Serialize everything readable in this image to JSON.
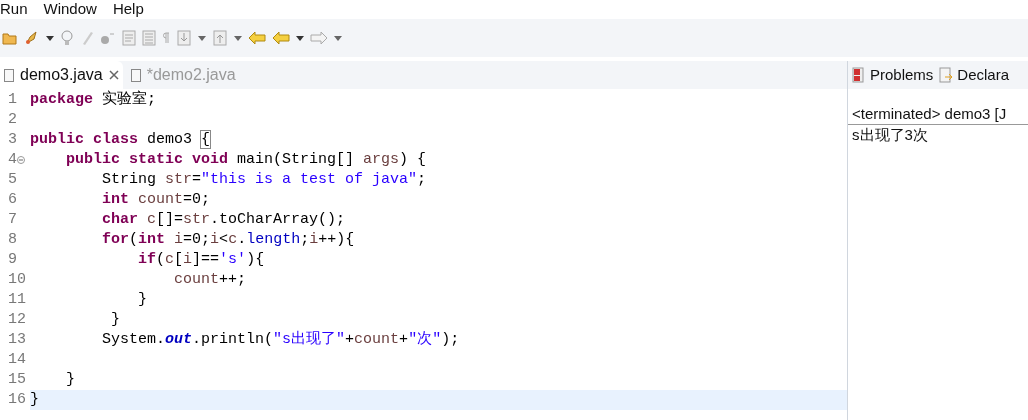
{
  "menu": [
    "Run",
    "Window",
    "Help"
  ],
  "editor_tabs": [
    {
      "label": "demo3.java",
      "selected": true,
      "closable": true
    },
    {
      "label": "*demo2.java",
      "selected": false,
      "closable": false
    }
  ],
  "code_lines": [
    {
      "number": "1",
      "fold": false,
      "current": false,
      "tokens": [
        {
          "kind": "keyword",
          "text": "package "
        },
        {
          "kind": "plain",
          "text": "实验室;"
        }
      ]
    },
    {
      "number": "2",
      "fold": false,
      "current": false
    },
    {
      "number": "3",
      "fold": false,
      "current": false,
      "tokens": [
        {
          "kind": "keyword",
          "text": "public class "
        },
        {
          "kind": "plain",
          "text": "demo3 "
        },
        {
          "kind": "matched_bracket",
          "text": "{"
        }
      ]
    },
    {
      "number": "4",
      "fold": true,
      "current": false,
      "tokens": [
        {
          "kind": "keyword",
          "text": "    public static void "
        },
        {
          "kind": "plain",
          "text": "main(String[] "
        },
        {
          "kind": "local",
          "text": "args"
        },
        {
          "kind": "plain",
          "text": ") {"
        }
      ]
    },
    {
      "number": "5",
      "fold": false,
      "current": false,
      "tokens": [
        {
          "kind": "plain",
          "text": "        String "
        },
        {
          "kind": "local",
          "text": "str"
        },
        {
          "kind": "plain",
          "text": "="
        },
        {
          "kind": "string",
          "text": "\"this is a test of java\""
        },
        {
          "kind": "plain",
          "text": ";"
        }
      ]
    },
    {
      "number": "6",
      "fold": false,
      "current": false,
      "tokens": [
        {
          "kind": "keyword",
          "text": "        int "
        },
        {
          "kind": "local",
          "text": "count"
        },
        {
          "kind": "plain",
          "text": "=0;"
        }
      ]
    },
    {
      "number": "7",
      "fold": false,
      "current": false,
      "tokens": [
        {
          "kind": "keyword",
          "text": "        char "
        },
        {
          "kind": "local",
          "text": "c"
        },
        {
          "kind": "plain",
          "text": "[]="
        },
        {
          "kind": "local",
          "text": "str"
        },
        {
          "kind": "plain",
          "text": ".toCharArray();"
        }
      ]
    },
    {
      "number": "8",
      "fold": false,
      "current": false,
      "tokens": [
        {
          "kind": "keyword",
          "text": "        for"
        },
        {
          "kind": "plain",
          "text": "("
        },
        {
          "kind": "keyword",
          "text": "int "
        },
        {
          "kind": "local",
          "text": "i"
        },
        {
          "kind": "plain",
          "text": "=0;"
        },
        {
          "kind": "local",
          "text": "i"
        },
        {
          "kind": "plain",
          "text": "<"
        },
        {
          "kind": "local",
          "text": "c"
        },
        {
          "kind": "plain",
          "text": "."
        },
        {
          "kind": "field",
          "text": "length"
        },
        {
          "kind": "plain",
          "text": ";"
        },
        {
          "kind": "local",
          "text": "i"
        },
        {
          "kind": "plain",
          "text": "++){"
        }
      ]
    },
    {
      "number": "9",
      "fold": false,
      "current": false,
      "tokens": [
        {
          "kind": "keyword",
          "text": "            if"
        },
        {
          "kind": "plain",
          "text": "("
        },
        {
          "kind": "local",
          "text": "c"
        },
        {
          "kind": "plain",
          "text": "["
        },
        {
          "kind": "local",
          "text": "i"
        },
        {
          "kind": "plain",
          "text": "]=="
        },
        {
          "kind": "string",
          "text": "'s'"
        },
        {
          "kind": "plain",
          "text": "){"
        }
      ]
    },
    {
      "number": "10",
      "fold": false,
      "current": false,
      "tokens": [
        {
          "kind": "local",
          "text": "                count"
        },
        {
          "kind": "plain",
          "text": "++;"
        }
      ]
    },
    {
      "number": "11",
      "fold": false,
      "current": false,
      "tokens": [
        {
          "kind": "plain",
          "text": "            }"
        }
      ]
    },
    {
      "number": "12",
      "fold": false,
      "current": false,
      "tokens": [
        {
          "kind": "plain",
          "text": "         }"
        }
      ]
    },
    {
      "number": "13",
      "fold": false,
      "current": false,
      "tokens": [
        {
          "kind": "plain",
          "text": "        System."
        },
        {
          "kind": "static_field",
          "text": "out"
        },
        {
          "kind": "plain",
          "text": ".println("
        },
        {
          "kind": "string",
          "text": "\"s出现了\""
        },
        {
          "kind": "plain",
          "text": "+"
        },
        {
          "kind": "local",
          "text": "count"
        },
        {
          "kind": "plain",
          "text": "+"
        },
        {
          "kind": "string",
          "text": "\"次\""
        },
        {
          "kind": "plain",
          "text": ");"
        }
      ]
    },
    {
      "number": "14",
      "fold": false,
      "current": false
    },
    {
      "number": "15",
      "fold": false,
      "current": false,
      "tokens": [
        {
          "kind": "plain",
          "text": "    }"
        }
      ]
    },
    {
      "number": "16",
      "fold": false,
      "current": true,
      "tokens": [
        {
          "kind": "plain",
          "text": "}"
        }
      ]
    }
  ],
  "view_tabs": [
    {
      "label": "Problems",
      "kind": "problems"
    },
    {
      "label": "Declara",
      "kind": "declaration"
    }
  ],
  "console": {
    "header": "<terminated> demo3 [J",
    "output": "s出现了3次"
  }
}
